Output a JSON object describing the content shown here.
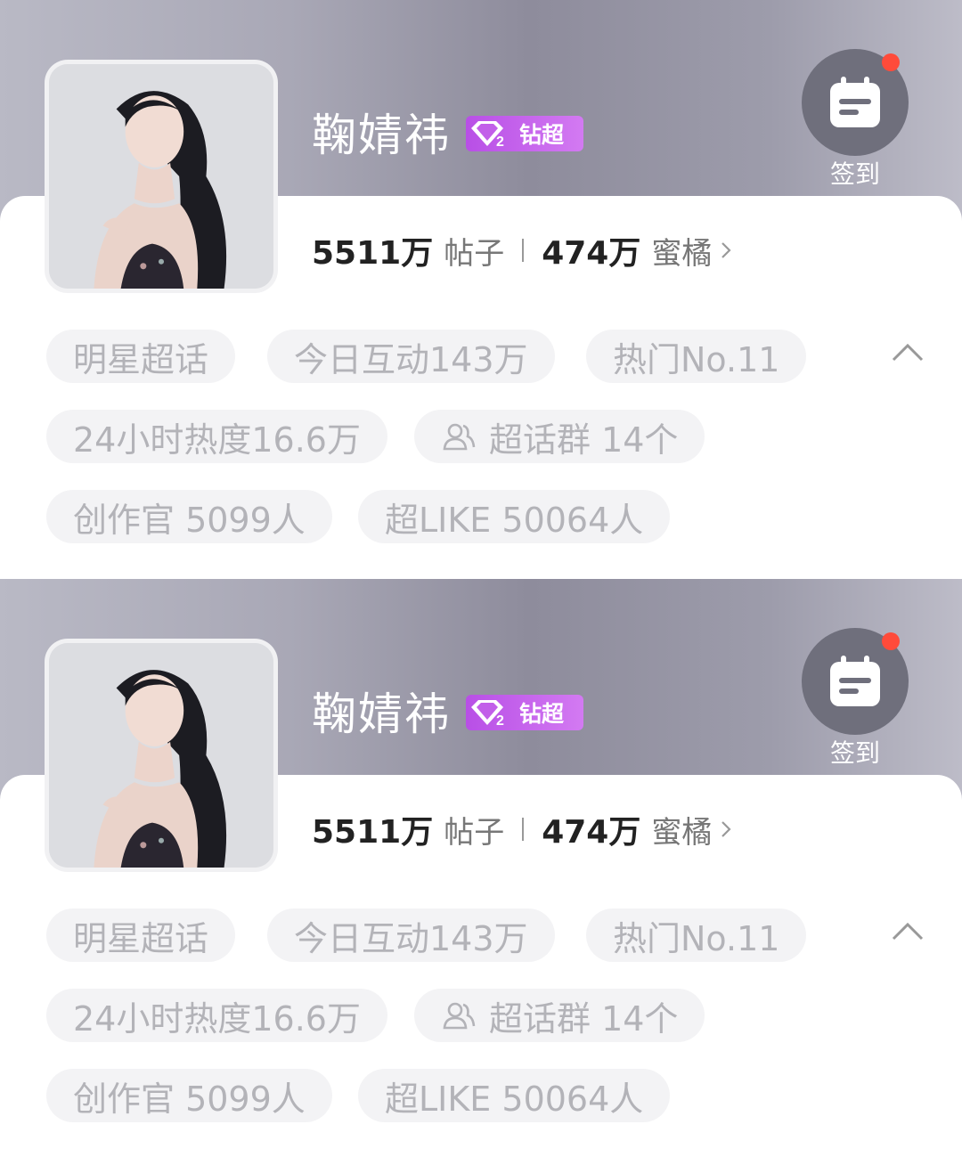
{
  "panels": [
    {
      "name": "鞠婧祎",
      "badge": "钻超",
      "checkin": "签到",
      "posts_count": "5511万",
      "posts_label": "帖子",
      "fans_count": "474万",
      "fans_label": "蜜橘",
      "tags": [
        "明星超话",
        "今日互动143万",
        "热门No.11",
        "24小时热度16.6万",
        "超话群 14个",
        "创作官 5099人",
        "超LIKE 50064人"
      ]
    },
    {
      "name": "鞠婧祎",
      "badge": "钻超",
      "checkin": "签到",
      "posts_count": "5511万",
      "posts_label": "帖子",
      "fans_count": "474万",
      "fans_label": "蜜橘",
      "tags": [
        "明星超话",
        "今日互动143万",
        "热门No.11",
        "24小时热度16.6万",
        "超话群 14个",
        "创作官 5099人",
        "超LIKE 50064人"
      ]
    }
  ],
  "colors": {
    "badge": "#c25fe9",
    "notification_dot": "#ff4b3a",
    "tag_bg": "#f3f3f5",
    "tag_text": "#b3b3b8"
  },
  "icons": [
    "calendar-icon",
    "diamond-badge-icon",
    "chevron-right-icon",
    "chevron-up-icon",
    "group-icon"
  ]
}
